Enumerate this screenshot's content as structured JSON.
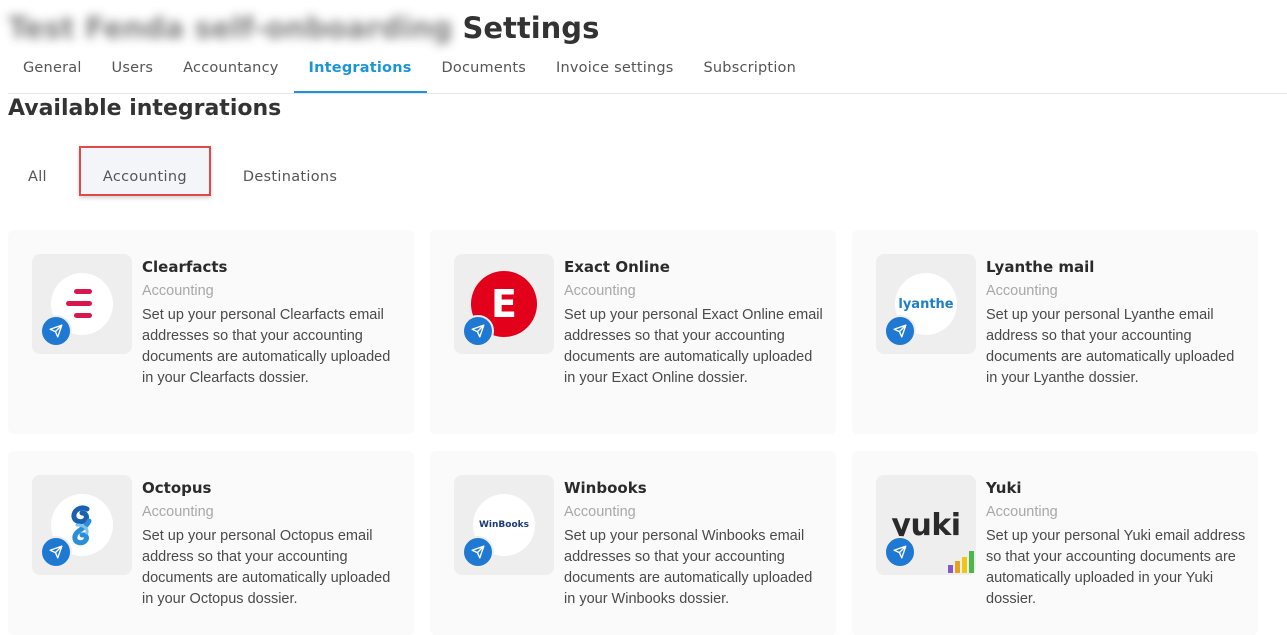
{
  "header": {
    "company_name": "Test Fenda self-onboarding",
    "title": "Settings"
  },
  "tabs": [
    {
      "label": "General"
    },
    {
      "label": "Users"
    },
    {
      "label": "Accountancy"
    },
    {
      "label": "Integrations"
    },
    {
      "label": "Documents"
    },
    {
      "label": "Invoice settings"
    },
    {
      "label": "Subscription"
    }
  ],
  "active_tab": "Integrations",
  "section_title": "Available integrations",
  "filters": [
    {
      "label": "All"
    },
    {
      "label": "Accounting"
    },
    {
      "label": "Destinations"
    }
  ],
  "active_filter": "Accounting",
  "integrations": [
    {
      "name": "Clearfacts",
      "category": "Accounting",
      "description": "Set up your personal Clearfacts email addresses so that your accounting documents are automatically uploaded in your Clearfacts dossier.",
      "logo_icon": "clearfacts-logo-icon"
    },
    {
      "name": "Exact Online",
      "category": "Accounting",
      "description": "Set up your personal Exact Online email addresses so that your accounting documents are automatically uploaded in your Exact Online dossier.",
      "logo_icon": "exact-online-logo-icon",
      "logo_text": "E"
    },
    {
      "name": "Lyanthe mail",
      "category": "Accounting",
      "description": "Set up your personal Lyanthe email address so that your accounting documents are automatically uploaded in your Lyanthe dossier.",
      "logo_icon": "lyanthe-logo-icon",
      "logo_text": "lyanthe"
    },
    {
      "name": "Octopus",
      "category": "Accounting",
      "description": "Set up your personal Octopus email address so that your accounting documents are automatically uploaded in your Octopus dossier.",
      "logo_icon": "octopus-logo-icon"
    },
    {
      "name": "Winbooks",
      "category": "Accounting",
      "description": "Set up your personal Winbooks email addresses so that your accounting documents are automatically uploaded in your Winbooks dossier.",
      "logo_icon": "winbooks-logo-icon",
      "logo_text": "WinBooks"
    },
    {
      "name": "Yuki",
      "category": "Accounting",
      "description": "Set up your personal Yuki email address so that your accounting documents are automatically uploaded in your Yuki dossier.",
      "logo_icon": "yuki-logo-icon",
      "logo_text": "yuki"
    }
  ],
  "colors": {
    "accent": "#1c95d8",
    "badge": "#1f78d1",
    "highlight_border": "#e0484a",
    "exact_red": "#e2001a",
    "clearfacts_red": "#d8174f"
  },
  "badge_icon": "send-icon"
}
